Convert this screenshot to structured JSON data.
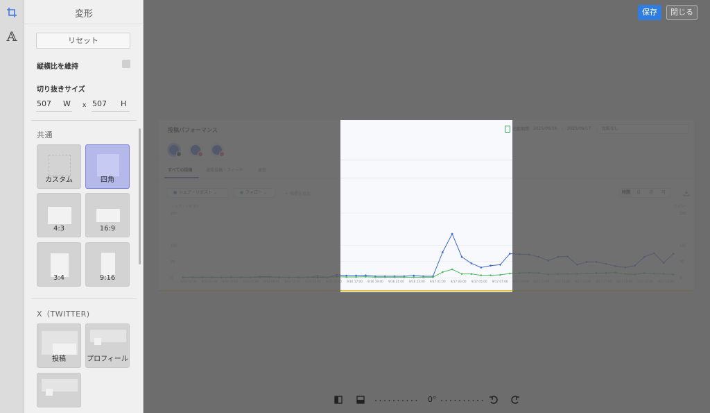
{
  "panel": {
    "title": "変形",
    "reset_label": "リセット",
    "aspect_label": "縦横比を維持",
    "size_label": "切り抜きサイズ",
    "width_value": "507",
    "width_unit": "W",
    "separator": "x",
    "height_value": "507",
    "height_unit": "H",
    "section_common": "共通",
    "section_x": "X（TWITTER)",
    "common_presets": [
      {
        "label": "カスタム"
      },
      {
        "label": "四角",
        "selected": true
      },
      {
        "label": "4:3"
      },
      {
        "label": "16:9"
      },
      {
        "label": "3:4"
      },
      {
        "label": "9:16"
      }
    ],
    "x_presets": [
      {
        "label": "投稿"
      },
      {
        "label": "プロフィール"
      }
    ]
  },
  "header": {
    "save_label": "保存",
    "close_label": "閉じる"
  },
  "bottom_bar": {
    "rotation_value": "0°"
  },
  "chart_data": {
    "type": "line",
    "title": "投稿パフォーマンス",
    "date_compare_label": "比較期間",
    "date_from": "2025/09/16",
    "date_sep": "-",
    "date_to": "2025/09/17",
    "compare_option": "比較なし",
    "tabs": [
      "すべての投稿",
      "通常投稿・フィード",
      "返信"
    ],
    "metric_pills": [
      "シェア・リポスト",
      "フォロー"
    ],
    "add_metric": "+ 指標を追加",
    "granularity": [
      "時間",
      "日",
      "週",
      "月"
    ],
    "y_left_label": "シェア・リポスト",
    "y_right_label": "フォロー",
    "ylim": [
      0,
      280
    ],
    "y_ticks": [
      0,
      70,
      140,
      280
    ],
    "x_tick_labels": [
      "9/16 01:00",
      "9/16 03:00",
      "9/16 05:00",
      "9/16 07:00",
      "9/16 09:00",
      "9/16 11:00",
      "9/16 13:00",
      "9/16 15:00",
      "9/16 17:00",
      "9/16 19:00",
      "9/16 21:00",
      "9/16 23:00",
      "9/17 01:00",
      "9/17 03:00",
      "9/17 05:00",
      "9/17 07:00",
      "9/17 09:00",
      "9/17 11:00",
      "9/17 13:00",
      "9/17 15:00",
      "9/17 17:00",
      "9/17 19:00",
      "9/17 21:00",
      "9/17 23:00"
    ],
    "series": [
      {
        "name": "シェア・リポスト",
        "color": "#3b66d6",
        "values": [
          2,
          2,
          2,
          2,
          2,
          2,
          2,
          2,
          4,
          4,
          2,
          2,
          2,
          2,
          1,
          1,
          12,
          9,
          9,
          10,
          6,
          6,
          6,
          6,
          9,
          6,
          6,
          110,
          190,
          90,
          62,
          44,
          52,
          56,
          104,
          102,
          100,
          90,
          74,
          90,
          92,
          56,
          68,
          68,
          60,
          50,
          44,
          52,
          90,
          106,
          64,
          104
        ]
      },
      {
        "name": "フォロー",
        "color": "#4cbb5c",
        "values": [
          1,
          1,
          1,
          1,
          1,
          1,
          1,
          1,
          2,
          2,
          1,
          1,
          1,
          1,
          8,
          1,
          4,
          3,
          3,
          4,
          2,
          2,
          2,
          2,
          2,
          2,
          2,
          24,
          36,
          16,
          16,
          10,
          10,
          12,
          18,
          20,
          22,
          20,
          14,
          16,
          16,
          16,
          18,
          20,
          20,
          22,
          16,
          14,
          20,
          18,
          16,
          14
        ]
      }
    ]
  }
}
